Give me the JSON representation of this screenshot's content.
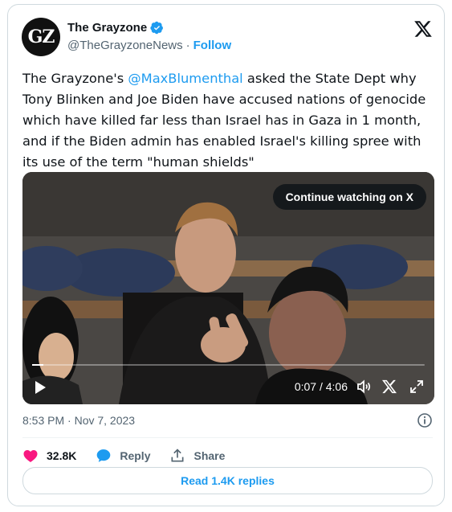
{
  "author": {
    "avatar_text": "GZ",
    "name": "The Grayzone",
    "handle": "@TheGrayzoneNews",
    "separator": "·",
    "follow_label": "Follow"
  },
  "tweet": {
    "text_before": "The Grayzone's ",
    "mention": "@MaxBlumenthal",
    "text_after": " asked the State Dept why Tony Blinken and Joe Biden have accused nations of genocide which have killed far less than Israel has in Gaza in 1 month, and if the Biden admin has enabled Israel's killing spree with its use of the term \"human shields\""
  },
  "video": {
    "continue_label": "Continue watching on X",
    "time_label": "0:07 / 4:06",
    "progress": 0.028
  },
  "meta": {
    "timestamp": "8:53 PM · Nov 7, 2023"
  },
  "actions": {
    "likes": "32.8K",
    "reply_label": "Reply",
    "share_label": "Share",
    "read_replies_label": "Read 1.4K replies"
  },
  "icons": {
    "verified": "verified-badge-icon",
    "brand": "x-logo-icon",
    "like_color": "#f91880",
    "reply_color": "#1d9bf0",
    "accent": "#1d9bf0"
  }
}
